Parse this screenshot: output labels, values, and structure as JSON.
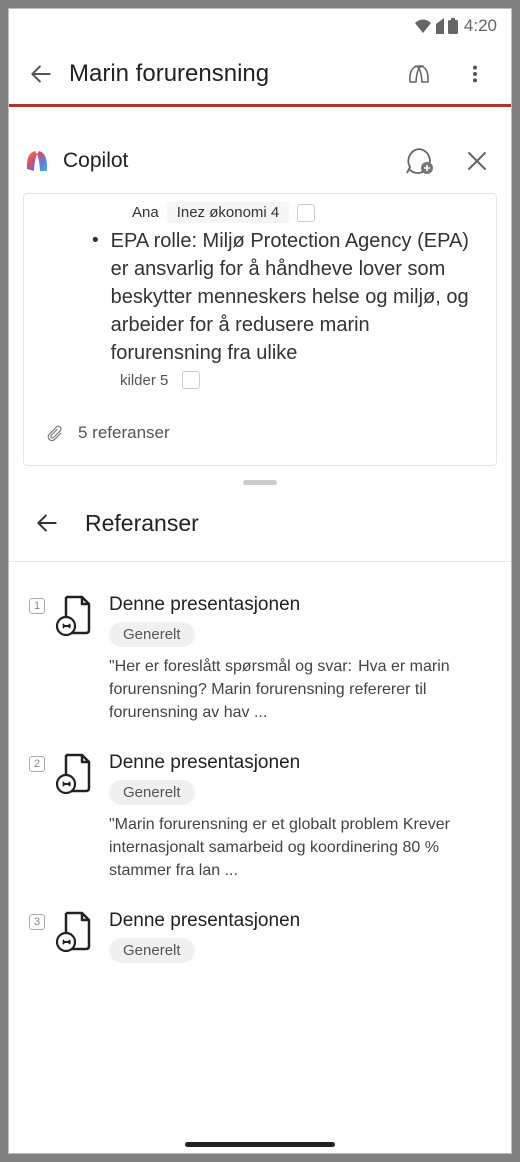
{
  "status_bar": {
    "time": "4:20"
  },
  "app_header": {
    "title": "Marin forurensning"
  },
  "copilot_header": {
    "title": "Copilot"
  },
  "card": {
    "top_ana": "Ana",
    "top_pill": "Inez økonomi 4",
    "bullet": "EPA rolle: Miljø Protection Agency (EPA) er ansvarlig for å håndheve lover som beskytter menneskers helse og miljø, og arbeider for å redusere marin forurensning fra ulike",
    "source": "kilder 5",
    "references_label": "5 referanser"
  },
  "ref_panel": {
    "title": "Referanser",
    "items": [
      {
        "num": "1",
        "title": "Denne presentasjonen",
        "badge": "Generelt",
        "quote_prefix": "\"Her er foreslått spørsmål og svar:",
        "quote_body": "Hva er marin forurensning?   Marin forurensning refererer til forurensning av hav ..."
      },
      {
        "num": "2",
        "title": "Denne presentasjonen",
        "badge": "Generelt",
        "quote_prefix": "",
        "quote_body": "\"Marin forurensning er et globalt problem Krever internasjonalt samarbeid og koordinering 80 % stammer fra lan ..."
      },
      {
        "num": "3",
        "title": "Denne presentasjonen",
        "badge": "Generelt",
        "quote_prefix": "",
        "quote_body": ""
      }
    ]
  }
}
